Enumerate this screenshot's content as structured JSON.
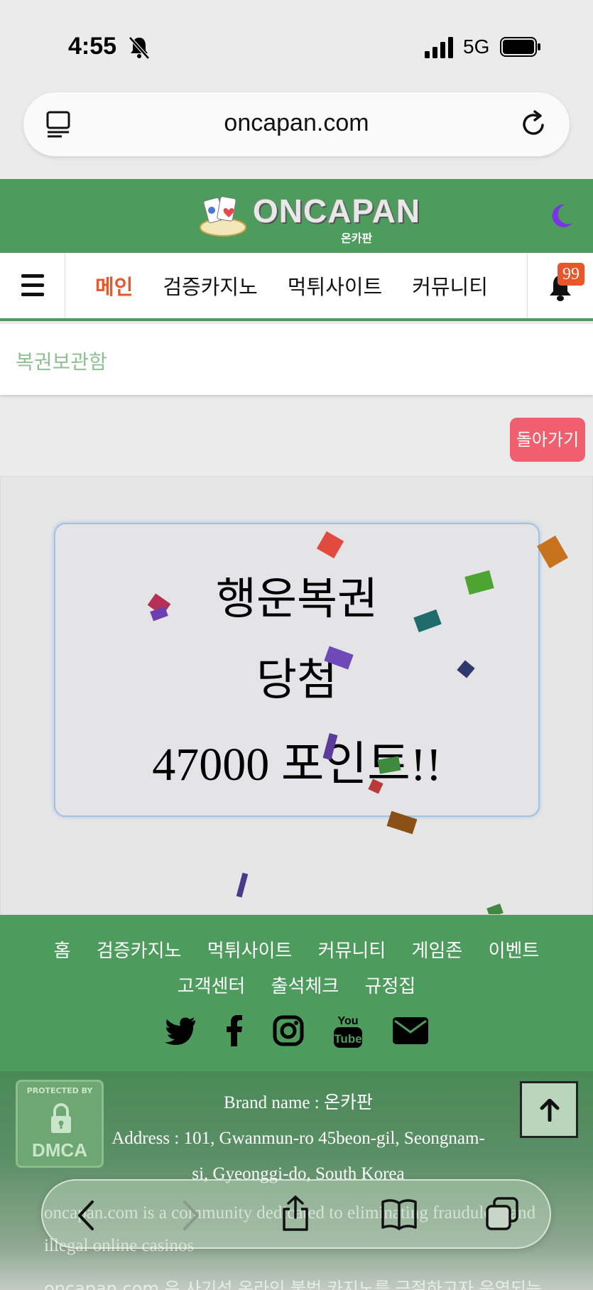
{
  "status_bar": {
    "time": "4:55",
    "network": "5G"
  },
  "browser": {
    "url": "oncapan.com"
  },
  "header": {
    "logo_text": "ONCAPAN",
    "logo_sub": "온카판"
  },
  "nav": {
    "items": [
      {
        "label": "메인",
        "active": true
      },
      {
        "label": "검증카지노",
        "active": false
      },
      {
        "label": "먹튀사이트",
        "active": false
      },
      {
        "label": "커뮤니티",
        "active": false
      }
    ],
    "notification_count": "99"
  },
  "breadcrumb": {
    "title": "복권보관함"
  },
  "back_button": {
    "label": "돌아가기"
  },
  "prize": {
    "line1": "행운복권",
    "line2": "당첨",
    "line3": "47000 포인트!!"
  },
  "footer": {
    "links_row1": [
      "홈",
      "검증카지노",
      "먹튀사이트",
      "커뮤니티",
      "게임존",
      "이벤트"
    ],
    "links_row2": [
      "고객센터",
      "출석체크",
      "규정집"
    ],
    "social": [
      "twitter-icon",
      "facebook-icon",
      "instagram-icon",
      "youtube-icon",
      "mail-icon"
    ],
    "dmca_top": "PROTECTED BY",
    "dmca_bottom": "DMCA",
    "brand_name": "Brand name : 온카판",
    "address_line1": "Address : 101, Gwanmun-ro 45beon-gil, Seongnam-",
    "address_line2": "si, Gyeonggi-do, South Korea",
    "para1_line1": "oncapan.com is a community dedicated to eliminating fraudulent and",
    "para1_line2": "illegal online casinos",
    "para2_line1": "oncapan.com 은 사기성 온라인 불법 카지노를 근절하고자 운영되는 커뮤"
  },
  "colors": {
    "brand_green": "#4e9b5e",
    "active_nav": "#e8562a",
    "back_button": "#ef5f6d",
    "card_border": "#9ec3e6"
  }
}
